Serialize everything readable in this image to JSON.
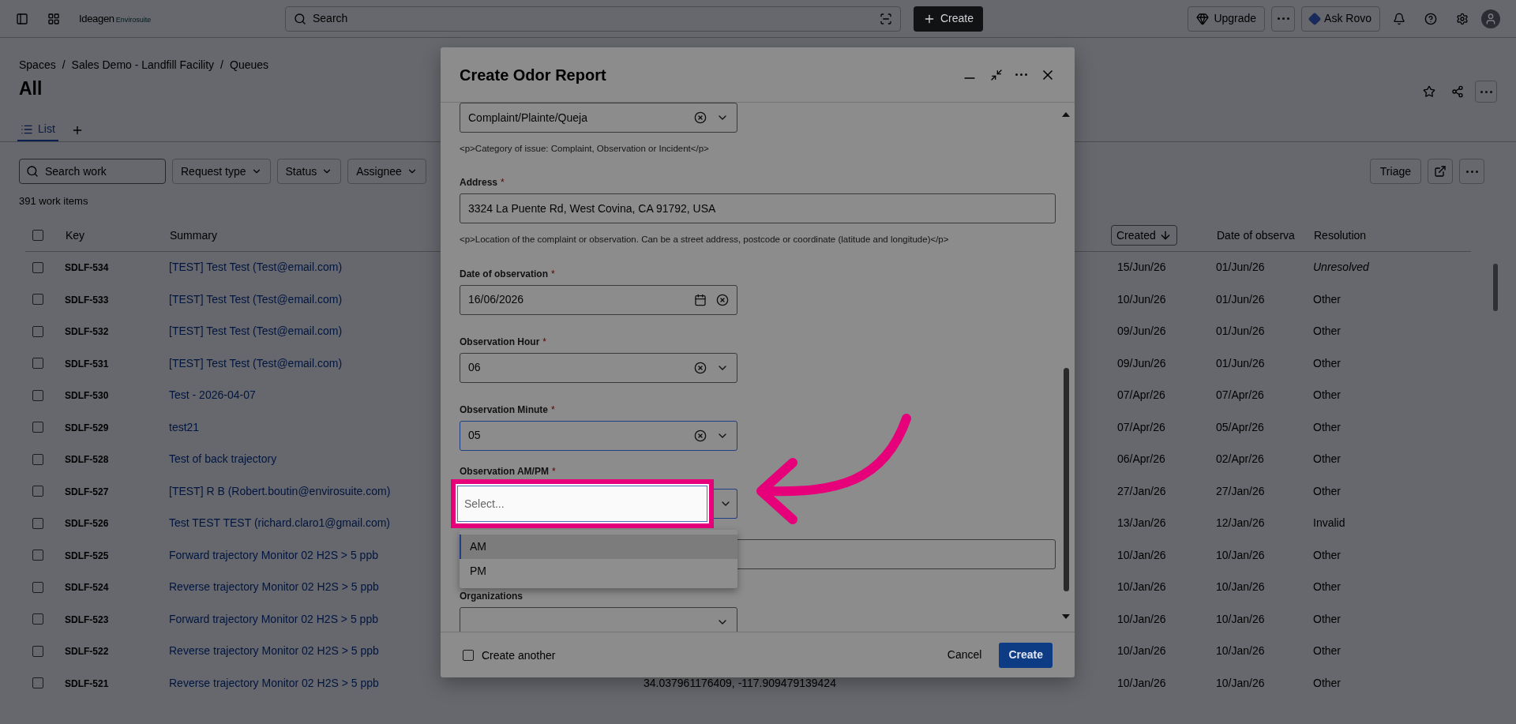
{
  "top_bar": {
    "logo": "Ideagen",
    "logo_sub": "Envirosuite",
    "search_placeholder": "Search",
    "create": "Create",
    "upgrade": "Upgrade",
    "ask_rovo": "Ask Rovo"
  },
  "breadcrumbs": [
    {
      "label": "Spaces"
    },
    {
      "separator": "/",
      "label": "Sales Demo - Landfill Facility"
    },
    {
      "separator": "/",
      "label": "Queues"
    }
  ],
  "page_title": "All",
  "tabs": [
    {
      "label": "List",
      "selected": true
    }
  ],
  "search_placeholder": "Search work",
  "filters": [
    "Request type",
    "Status",
    "Assignee"
  ],
  "triage": "Triage",
  "count": "391 work items",
  "table": {
    "select_all_checked": false,
    "columns": [
      {
        "label": "Key",
        "sorted": false
      },
      {
        "label": "Summary",
        "sorted": false
      },
      {
        "label": "Created",
        "sorted": true
      },
      {
        "label": "Date of observa",
        "sorted": false
      },
      {
        "label": "Resolution",
        "sorted": false
      }
    ],
    "rows": [
      {
        "key": "SDLF-534",
        "summary": "[TEST] Test Test (Test@email.com)",
        "created": "15/Jun/26",
        "observed": "01/Jun/26",
        "resolution": "Unresolved",
        "resolved": false,
        "checked": false
      },
      {
        "key": "SDLF-533",
        "summary": "[TEST] Test Test (Test@email.com)",
        "created": "10/Jun/26",
        "observed": "01/Jun/26",
        "resolution": "Other",
        "resolved": true,
        "checked": false
      },
      {
        "key": "SDLF-532",
        "summary": "[TEST] Test Test (Test@email.com)",
        "created": "09/Jun/26",
        "observed": "01/Jun/26",
        "resolution": "Other",
        "resolved": true,
        "checked": false
      },
      {
        "key": "SDLF-531",
        "summary": "[TEST] Test Test (Test@email.com)",
        "created": "09/Jun/26",
        "observed": "01/Jun/26",
        "resolution": "Other",
        "resolved": true,
        "checked": false
      },
      {
        "key": "SDLF-530",
        "summary": "Test - 2026-04-07",
        "created": "07/Apr/26",
        "observed": "07/Apr/26",
        "resolution": "Other",
        "resolved": true,
        "checked": false
      },
      {
        "key": "SDLF-529",
        "summary": "test21",
        "created": "07/Apr/26",
        "observed": "05/Apr/26",
        "resolution": "Other",
        "resolved": true,
        "checked": false
      },
      {
        "key": "SDLF-528",
        "summary": "Test of back trajectory",
        "created": "06/Apr/26",
        "observed": "02/Apr/26",
        "resolution": "Other",
        "resolved": true,
        "checked": false
      },
      {
        "key": "SDLF-527",
        "summary": "[TEST] R B (Robert.boutin@envirosuite.com)",
        "created": "27/Jan/26",
        "observed": "27/Jan/26",
        "resolution": "Other",
        "resolved": true,
        "checked": false
      },
      {
        "key": "SDLF-526",
        "summary": "Test TEST TEST (richard.claro1@gmail.com)",
        "created": "13/Jan/26",
        "observed": "12/Jan/26",
        "resolution": "Invalid",
        "resolved": true,
        "checked": false
      },
      {
        "key": "SDLF-525",
        "summary": "Forward trajectory Monitor 02 H2S > 5 ppb",
        "created": "10/Jan/26",
        "observed": "10/Jan/26",
        "resolution": "Other",
        "resolved": true,
        "checked": false
      },
      {
        "key": "SDLF-524",
        "summary": "Reverse trajectory Monitor 02 H2S > 5 ppb",
        "created": "10/Jan/26",
        "observed": "10/Jan/26",
        "resolution": "Other",
        "resolved": true,
        "checked": false
      },
      {
        "key": "SDLF-523",
        "summary": "Forward trajectory Monitor 02 H2S > 5 ppb",
        "created": "10/Jan/26",
        "observed": "10/Jan/26",
        "resolution": "Other",
        "resolved": true,
        "checked": false
      },
      {
        "key": "SDLF-522",
        "summary": "Reverse trajectory Monitor 02 H2S > 5 ppb",
        "created": "10/Jan/26",
        "observed": "10/Jan/26",
        "resolution": "Other",
        "resolved": true,
        "checked": false
      },
      {
        "key": "SDLF-521",
        "summary": "Reverse trajectory Monitor 02 H2S > 5 ppb",
        "column_4": "34.037961176409, -117.909479139424",
        "created": "10/Jan/26",
        "observed": "10/Jan/26",
        "resolution": "Other",
        "resolved": true,
        "checked": false
      }
    ]
  },
  "modal": {
    "title": "Create Odor Report",
    "fields": [
      {
        "kind": "select",
        "value": "Complaint/Plainte/Queja",
        "helper": "<p>Category of issue: Complaint, Observation or Incident</p>"
      },
      {
        "kind": "text",
        "label": "Address",
        "required_mark": "*",
        "value": "3324 La Puente Rd, West Covina, CA 91792, USA",
        "helper": "<p>Location of the complaint or observation. Can be a street address, postcode or coordinate (latitude and longitude)</p>"
      },
      {
        "kind": "date",
        "label": "Date of observation",
        "required_mark": "*",
        "value": "16/06/2026"
      },
      {
        "kind": "select",
        "label": "Observation Hour",
        "required_mark": "*",
        "value": "06",
        "focused": false
      },
      {
        "kind": "select",
        "label": "Observation Minute",
        "required_mark": "*",
        "value": "05",
        "focused": true
      },
      {
        "kind": "open-select",
        "label": "Observation AM/PM",
        "required_mark": "*",
        "placeholder": "Select...",
        "options": [
          {
            "label": "AM",
            "selected": true
          },
          {
            "label": "PM",
            "selected": false
          }
        ]
      },
      {
        "kind": "text"
      },
      {
        "kind": "select",
        "label": "Organizations"
      }
    ],
    "create_another": {
      "label": "Create another",
      "checked": false
    },
    "cancel": "Cancel",
    "create": "Create"
  }
}
